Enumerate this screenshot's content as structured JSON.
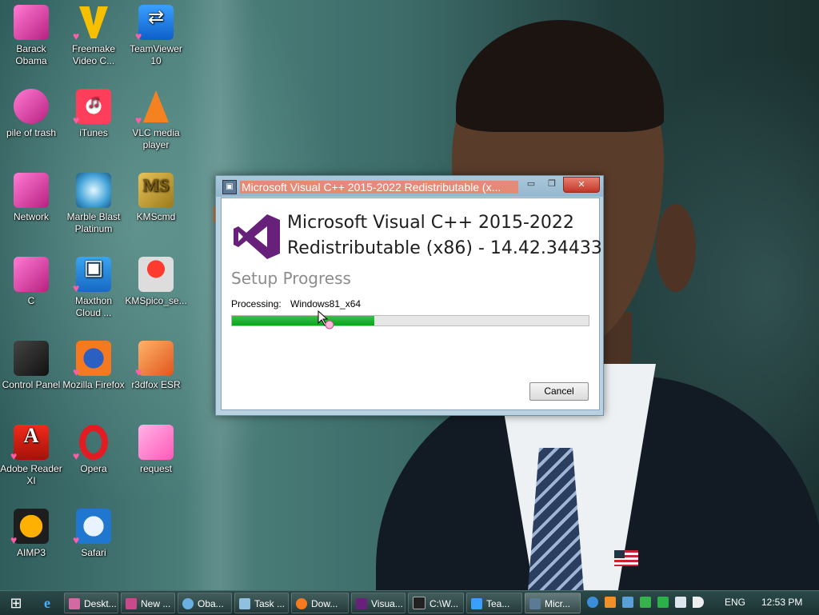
{
  "desktop": {
    "icons": [
      {
        "label": "Barack Obama",
        "icon": "doll-icon"
      },
      {
        "label": "Freemake Video C...",
        "icon": "freemake-icon"
      },
      {
        "label": "TeamViewer 10",
        "icon": "teamviewer-icon"
      },
      {
        "label": "pile of trash",
        "icon": "recycle-bin-icon"
      },
      {
        "label": "iTunes",
        "icon": "itunes-icon"
      },
      {
        "label": "VLC media player",
        "icon": "vlc-icon"
      },
      {
        "label": "Network",
        "icon": "network-icon"
      },
      {
        "label": "Marble Blast Platinum",
        "icon": "marble-blast-icon"
      },
      {
        "label": "KMScmd",
        "icon": "kmscmd-icon"
      },
      {
        "label": "C",
        "icon": "drive-icon"
      },
      {
        "label": "Maxthon Cloud ...",
        "icon": "maxthon-icon"
      },
      {
        "label": "KMSpico_se...",
        "icon": "kmspico-icon"
      },
      {
        "label": "Control Panel",
        "icon": "control-panel-icon"
      },
      {
        "label": "Mozilla Firefox",
        "icon": "firefox-icon"
      },
      {
        "label": "r3dfox ESR",
        "icon": "r3dfox-icon"
      },
      {
        "label": "Adobe Reader XI",
        "icon": "adobe-reader-icon"
      },
      {
        "label": "Opera",
        "icon": "opera-icon"
      },
      {
        "label": "request",
        "icon": "notebook-icon"
      },
      {
        "label": "AIMP3",
        "icon": "aimp-icon"
      },
      {
        "label": "Safari",
        "icon": "safari-icon"
      }
    ]
  },
  "installer": {
    "window_title": "Microsoft Visual C++ 2015-2022 Redistributable (x...",
    "product_line1": "Microsoft Visual C++ 2015-2022",
    "product_line2": "Redistributable (x86) - 14.42.34433",
    "section_title": "Setup Progress",
    "processing_label": "Processing:",
    "processing_value": "Windows81_x64",
    "progress": 0.4,
    "cancel_label": "Cancel",
    "accent": "#68217a",
    "progress_color": "#06b025"
  },
  "taskbar": {
    "tasks": [
      {
        "label": "Deskt...",
        "icon": "desktop-icon",
        "color": "#d06aa0"
      },
      {
        "label": "New ...",
        "icon": "new-window-icon",
        "color": "#c94a8a"
      },
      {
        "label": "Oba...",
        "icon": "globe-icon",
        "color": "#6ab0e0"
      },
      {
        "label": "Task ...",
        "icon": "task-manager-icon",
        "color": "#8fc0e0"
      },
      {
        "label": "Dow...",
        "icon": "firefox-icon",
        "color": "#f57a1f"
      },
      {
        "label": "Visua...",
        "icon": "installer-icon",
        "color": "#68217a"
      },
      {
        "label": "C:\\W...",
        "icon": "cmd-icon",
        "color": "#222222"
      },
      {
        "label": "Tea...",
        "icon": "teamviewer-icon",
        "color": "#3aa0ff"
      },
      {
        "label": "Micr...",
        "icon": "installer-icon",
        "color": "#5a7a96"
      }
    ],
    "language": "ENG",
    "clock": "12:53 PM"
  }
}
